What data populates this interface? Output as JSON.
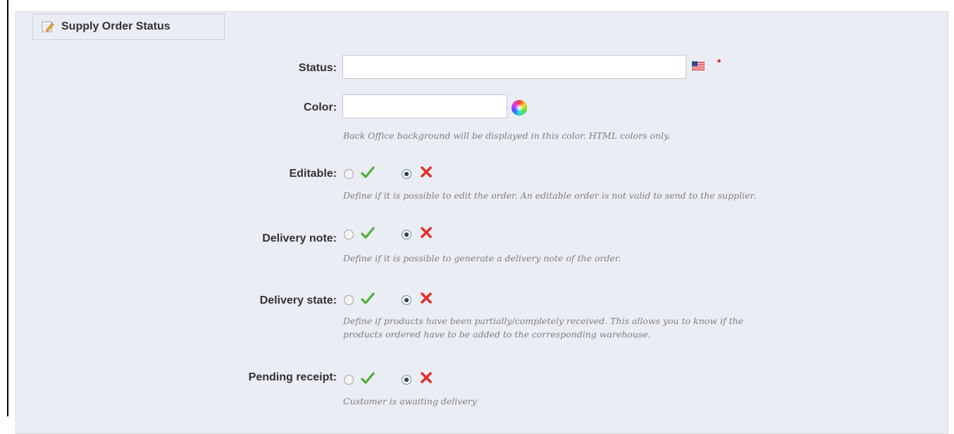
{
  "fieldset": {
    "title": "Supply Order Status",
    "icon": "pencil-icon"
  },
  "status": {
    "label": "Status:",
    "value": "",
    "flag_icon": "us-flag-icon",
    "required_mark": "*"
  },
  "color": {
    "label": "Color:",
    "value": "",
    "picker_icon": "color-wheel-icon",
    "hint": "Back Office background will be displayed in this color. HTML colors only."
  },
  "editable": {
    "label": "Editable:",
    "selected": "no",
    "hint": "Define if it is possible to edit the order. An editable order is not valid to send to the supplier."
  },
  "delivery_note": {
    "label": "Delivery note:",
    "selected": "no",
    "hint": "Define if it is possible to generate a delivery note of the order."
  },
  "delivery_state": {
    "label": "Delivery state:",
    "selected": "no",
    "hint_line1": "Define if products have been partially/completely received. This allows you to know if the",
    "hint_line2": "products ordered have to be added to the corresponding warehouse."
  },
  "pending_receipt": {
    "label": "Pending receipt:",
    "selected": "no",
    "hint": "Customer is awaiting delivery"
  },
  "colors": {
    "panel_bg": "#ebedf4",
    "yes_check": "#4fae3a",
    "no_cross": "#e0302a",
    "required": "#cc0000"
  }
}
